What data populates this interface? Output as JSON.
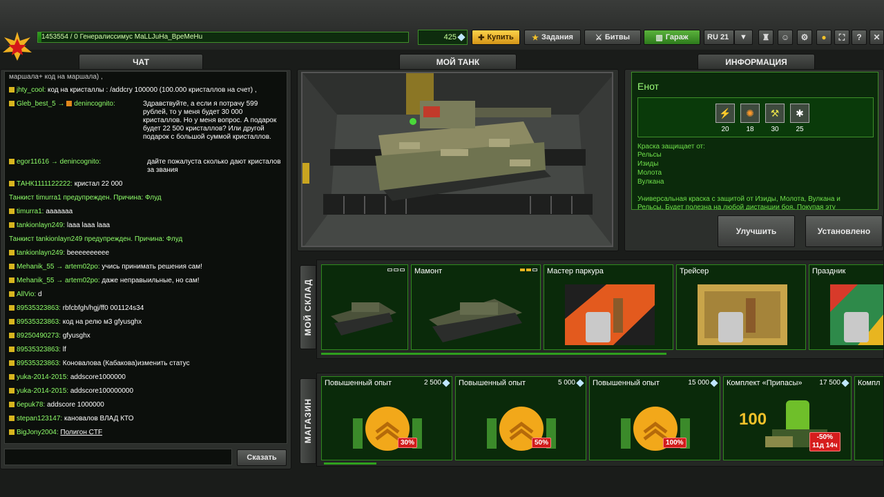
{
  "topbar": {
    "player_info": "1453554 / 0  Генералиссимус MaLLJuHa_BpeMeHu",
    "xp_progress": 0.01,
    "crystals": "425",
    "buy_label": "Купить",
    "tasks_label": "Задания",
    "battles_label": "Битвы",
    "garage_label": "Гараж",
    "server": "RU 21",
    "help_label": "?"
  },
  "chat": {
    "title": "ЧАТ",
    "send_label": "Сказать",
    "input_value": "",
    "top_fragment": "маршала+ код на маршала) ,",
    "lines": [
      {
        "nick": "jhty_cool:",
        "text": "код на кристаллы : /addcry 100000 (100.000 кристаллов на счет) ,"
      },
      {
        "nick": "Gleb_best_5 →",
        "target": "denincognito:",
        "text": "Здравствуйте, а если я потрачу 599 рублей, то у меня будет 30 000 кристаллов. Но у меня вопрос. А подарок будет 22 500 кристаллов? Или другой подарок с большой суммой кристаллов."
      },
      {
        "nick": "egor11616 →",
        "target": "denincognito:",
        "text": "дайте пожалуста сколько дают кристалов за звания"
      },
      {
        "nick": "ТАНК1111122222:",
        "text": "кристал 22 000"
      },
      {
        "system": "Танкист timurra1 предупрежден. Причина: Флуд"
      },
      {
        "nick": "timurra1:",
        "text": "ааааааа"
      },
      {
        "nick": "tankionlayn249:",
        "text": "laaa laaa laaa"
      },
      {
        "system": "Танкист tankionlayn249 предупрежден. Причина: Флуд"
      },
      {
        "nick": "tankionlayn249:",
        "text": "beeeeeeeeee"
      },
      {
        "nick": "Mehanik_55 →",
        "target": "artem02po:",
        "text": "учись принимать решения сам!"
      },
      {
        "nick": "Mehanik_55 →",
        "target": "artem02po:",
        "text": "даже неправыильные, но сам!"
      },
      {
        "nick": "AllVio:",
        "text": "d"
      },
      {
        "nick": "89535323863:",
        "text": "rbfcbfgh/hgj/ff0 001124s34"
      },
      {
        "nick": "89535323863:",
        "text": "код на релю м3 gfyusghx"
      },
      {
        "nick": "89250490273:",
        "text": "gfyusghx"
      },
      {
        "nick": "89535323863:",
        "text": "lf"
      },
      {
        "nick": "89535323863:",
        "text": "Коновалова (Кабакова)изменить статус"
      },
      {
        "nick": "yuka-2014-2015:",
        "text": "addscore1000000"
      },
      {
        "nick": "yuka-2014-2015:",
        "text": "addscore100000000"
      },
      {
        "nick": "берuk78:",
        "text": "addscore 1000000"
      },
      {
        "nick": "stepan123147:",
        "text": "кановалов ВЛАД КТО"
      },
      {
        "nick": "BigJony2004:",
        "text": "Полигон CTF"
      }
    ]
  },
  "tank": {
    "title": "МОЙ ТАНК"
  },
  "info": {
    "title": "ИНФОРМАЦИЯ",
    "item_name": "Енот",
    "protections": [
      {
        "icon": "railgun-icon",
        "value": "20"
      },
      {
        "icon": "isida-icon",
        "value": "18"
      },
      {
        "icon": "hammer-icon",
        "value": "30"
      },
      {
        "icon": "vulcan-icon",
        "value": "25"
      }
    ],
    "protects_from_label": "Краска защищает от:",
    "protects_from": [
      "Рельсы",
      "Изиды",
      "Молота",
      "Вулкана"
    ],
    "description": "Универсальная краска с защитой от Изиды, Молота, Вулкана и Рельсы. Будет полезна на любой дистанции боя. Покупая эту краску,",
    "upgrade_label": "Улучшить",
    "installed_label": "Установлено"
  },
  "warehouse": {
    "title": "МОЙ СКЛАД",
    "items": [
      {
        "name": "",
        "upgrades": 0
      },
      {
        "name": "Мамонт",
        "upgrades": 2
      },
      {
        "name": "Мастер паркура"
      },
      {
        "name": "Трейсер"
      },
      {
        "name": "Праздник"
      }
    ]
  },
  "shop": {
    "title": "МАГАЗИН",
    "items": [
      {
        "name": "Повышенный опыт",
        "price": "2 500",
        "badge": "30%"
      },
      {
        "name": "Повышенный опыт",
        "price": "5 000",
        "badge": "50%"
      },
      {
        "name": "Повышенный опыт",
        "price": "15 000",
        "badge": "100%"
      },
      {
        "name": "Комплект «Припасы»",
        "price": "17 500",
        "count": "100",
        "badge": "-50%",
        "timer": "11д 14ч"
      },
      {
        "name": "Компл"
      }
    ]
  },
  "colors": {
    "accent_green": "#2fa01e",
    "gold": "#ffd34a",
    "badge_red": "#d11b1b"
  }
}
